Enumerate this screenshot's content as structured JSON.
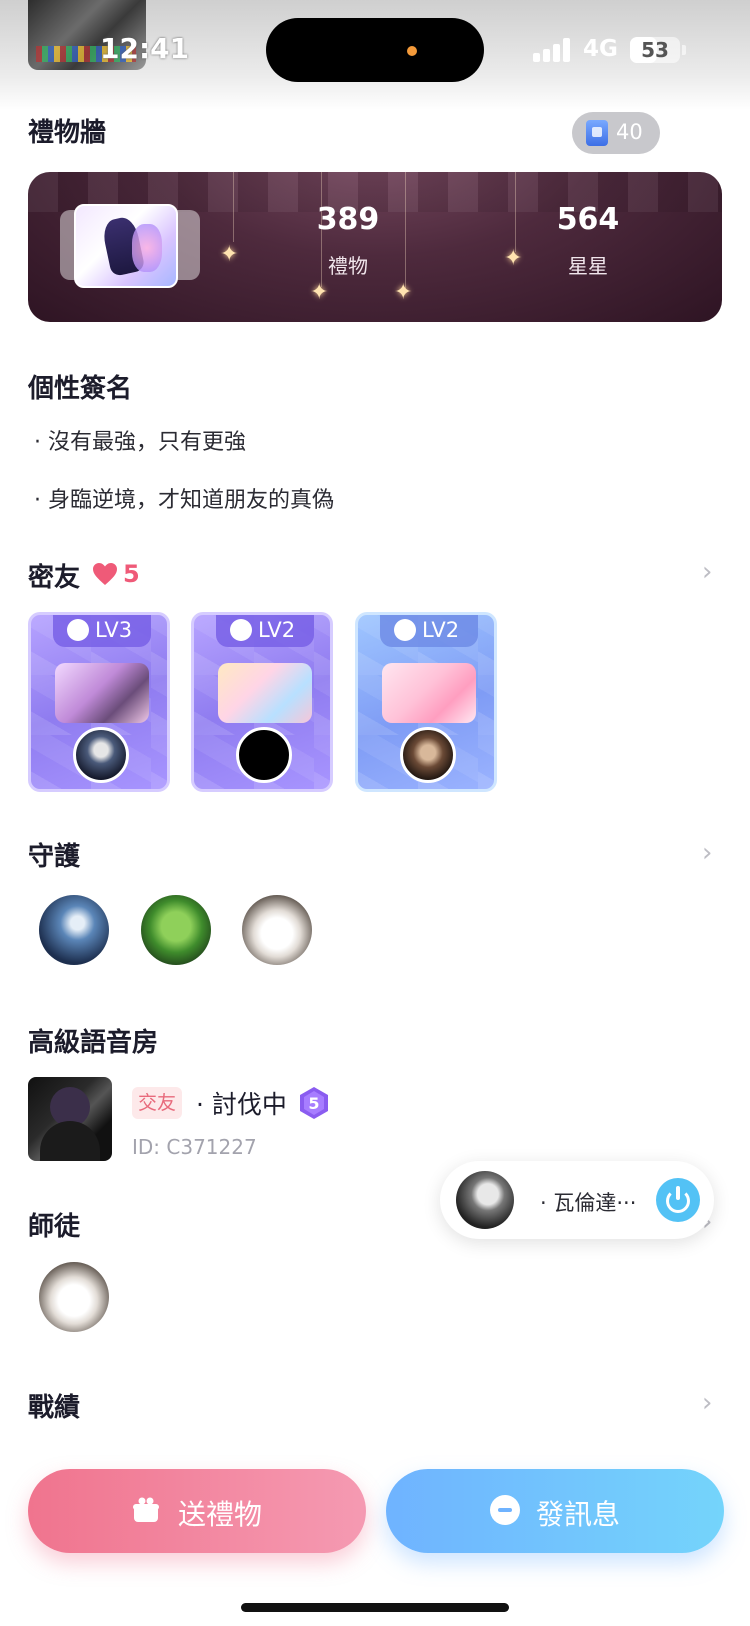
{
  "status_bar": {
    "time": "12:41",
    "network": "4G",
    "battery": "53",
    "battery_level": 0.53
  },
  "gift_wall": {
    "title": "禮物牆",
    "count": "40",
    "more_glyph": "··›",
    "stats": [
      {
        "value": "389",
        "label": "禮物"
      },
      {
        "value": "564",
        "label": "星星"
      }
    ]
  },
  "signature": {
    "title": "個性簽名",
    "lines": [
      "· 沒有最強，只有更強",
      "· 身臨逆境，才知道朋友的真偽"
    ]
  },
  "close_friends": {
    "title": "密友",
    "count": "5",
    "cards": [
      {
        "level": "LV3",
        "style": "purple",
        "item_icon": "motorcycle-icon"
      },
      {
        "level": "LV2",
        "style": "purple",
        "item_icon": "room-icon"
      },
      {
        "level": "LV2",
        "style": "blue",
        "item_icon": "boat-icon"
      }
    ]
  },
  "guardians": {
    "title": "守護"
  },
  "voice_room": {
    "title": "高級語音房",
    "tag": "交友",
    "name": "· 討伐中",
    "level": "5",
    "id": "ID: C371227"
  },
  "mentorship": {
    "title": "師徒"
  },
  "record": {
    "title": "戰績"
  },
  "floating_player": {
    "text": "· 瓦倫達···"
  },
  "buttons": {
    "send_gift": "送禮物",
    "send_message": "發訊息"
  },
  "colors": {
    "gift_button": "#f0748e",
    "message_button": "#6fb3ff",
    "heart": "#ef5a78",
    "accent_power": "#53c2f5"
  }
}
